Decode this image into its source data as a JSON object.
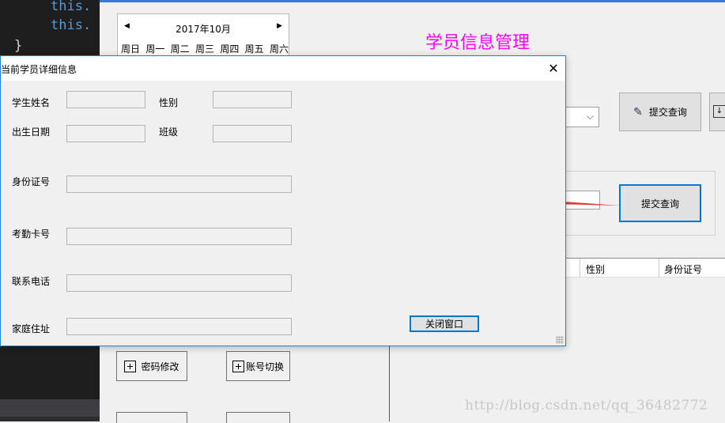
{
  "code_editor": {
    "line1": "this.",
    "line2": "this.",
    "line3": "}"
  },
  "calendar": {
    "month_label": "2017年10月",
    "weekdays": [
      "周日",
      "周一",
      "周二",
      "周三",
      "周四",
      "周五",
      "周六"
    ]
  },
  "app": {
    "title": "学员信息管理",
    "query_button_1": "提交查询",
    "query_button_2": "提交查询",
    "grid_columns": [
      "性别",
      "身份证号"
    ],
    "password_button": "密码修改",
    "switch_account_button": "账号切换",
    "title_color": "#ff00ff"
  },
  "dialog": {
    "title": "当前学员详细信息",
    "labels": {
      "name": "学生姓名",
      "gender": "性别",
      "birth": "出生日期",
      "class": "班级",
      "id_card": "身份证号",
      "attendance_card": "考勤卡号",
      "phone": "联系电话",
      "address": "家庭住址"
    },
    "fields": {
      "name": "",
      "gender": "",
      "birth": "",
      "class": "",
      "id_card": "",
      "attendance_card": "",
      "phone": "",
      "address": ""
    },
    "close_window_button": "关闭窗口"
  },
  "watermark": "http://blog.csdn.net/qq_36482772",
  "colors": {
    "accent": "#0078d7",
    "arrow": "#e53935",
    "editor_bg": "#1e1e1e",
    "keyword": "#569cd6"
  },
  "icons": [
    "close-icon",
    "query-icon",
    "plus-icon",
    "chevron-down-icon",
    "arrow-left-icon"
  ]
}
